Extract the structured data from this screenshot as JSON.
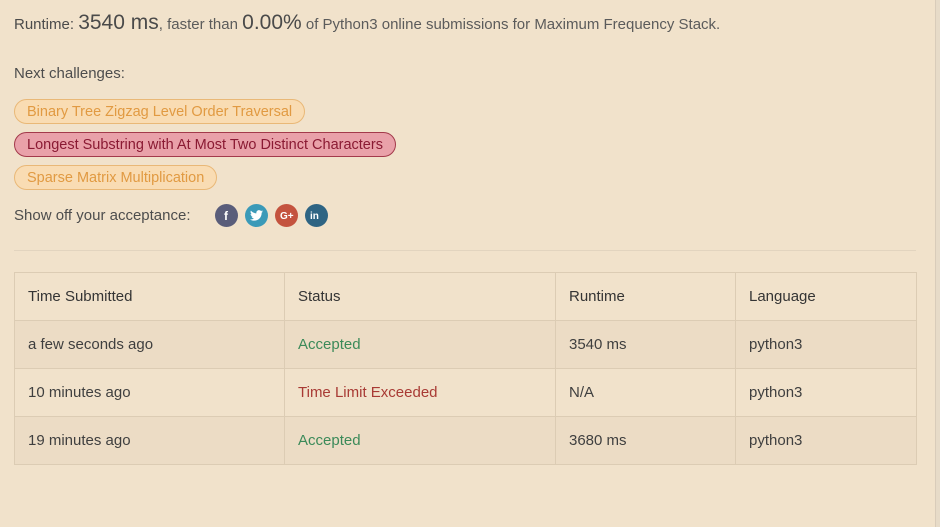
{
  "runtime": {
    "prefix": "Runtime:",
    "value": "3540 ms",
    "faster_text": ", faster than",
    "percent": "0.00%",
    "suffix": "of Python3 online submissions for Maximum Frequency Stack."
  },
  "next_challenges": {
    "label": "Next challenges:",
    "items": [
      {
        "title": "Binary Tree Zigzag Level Order Traversal",
        "difficulty": "medium"
      },
      {
        "title": "Longest Substring with At Most Two Distinct Characters",
        "difficulty": "hard"
      },
      {
        "title": "Sparse Matrix Multiplication",
        "difficulty": "medium"
      }
    ]
  },
  "share": {
    "label": "Show off your acceptance:",
    "icons": [
      "facebook-icon",
      "twitter-icon",
      "google-plus-icon",
      "linkedin-icon"
    ]
  },
  "table": {
    "headers": [
      "Time Submitted",
      "Status",
      "Runtime",
      "Language"
    ],
    "rows": [
      {
        "time": "a few seconds ago",
        "status": "Accepted",
        "runtime": "3540 ms",
        "language": "python3"
      },
      {
        "time": "10 minutes ago",
        "status": "Time Limit Exceeded",
        "runtime": "N/A",
        "language": "python3"
      },
      {
        "time": "19 minutes ago",
        "status": "Accepted",
        "runtime": "3680 ms",
        "language": "python3"
      }
    ]
  },
  "colors": {
    "background": "#f1e2cb",
    "accepted": "#3b8a59",
    "time_limit_exceeded": "#a83a34",
    "medium_chip": "#e19a42",
    "hard_chip": "#8a1a33"
  }
}
